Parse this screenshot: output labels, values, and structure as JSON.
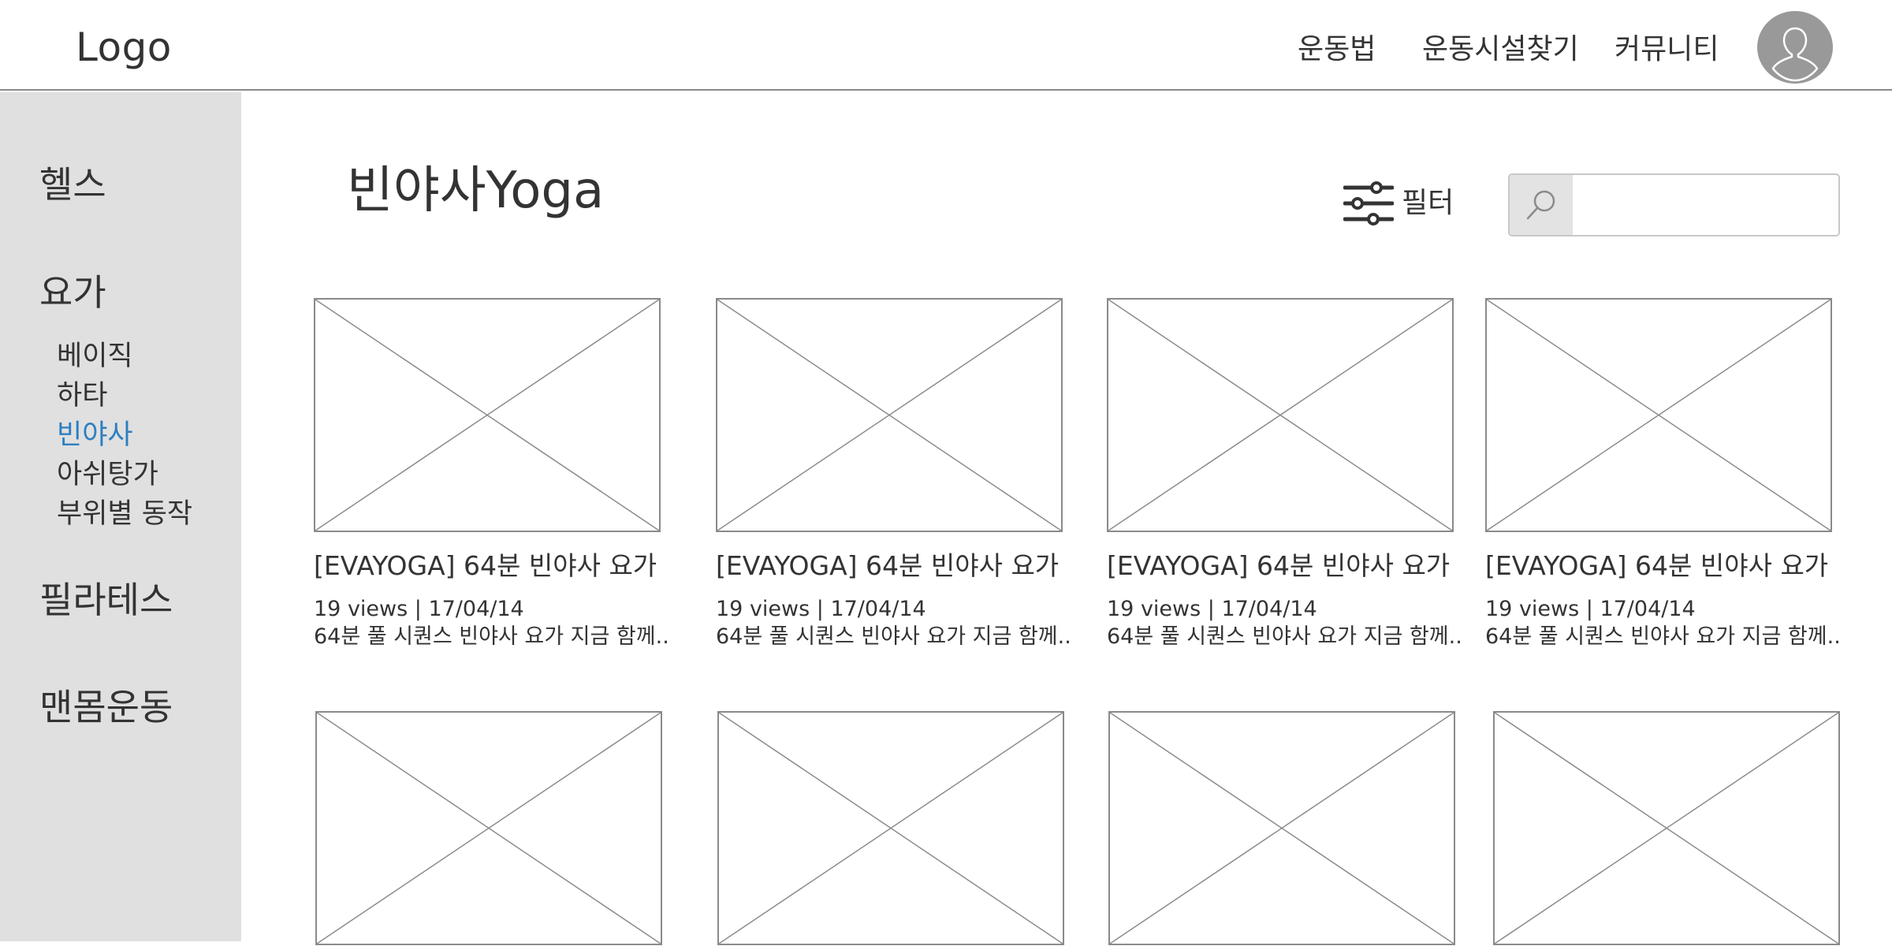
{
  "header": {
    "logo": "Logo",
    "nav": [
      "운동법",
      "운동시설찾기",
      "커뮤니티"
    ]
  },
  "sidebar": {
    "categories": [
      "헬스",
      "요가",
      "필라테스",
      "맨몸운동"
    ],
    "yoga_items": [
      "베이직",
      "하타",
      "빈야사",
      "아쉬탕가",
      "부위별 동작"
    ],
    "active_item": "빈야사"
  },
  "main": {
    "title": "빈야사Yoga",
    "filter_label": "필터",
    "search": {
      "value": "",
      "placeholder": ""
    }
  },
  "cards": [
    {
      "title": "[EVAYOGA] 64분 빈야사 요가",
      "meta": "19 views | 17/04/14",
      "desc": "64분 풀 시퀀스 빈야사 요가 지금 함께.."
    },
    {
      "title": "[EVAYOGA] 64분 빈야사 요가",
      "meta": "19 views | 17/04/14",
      "desc": "64분 풀 시퀀스 빈야사 요가 지금 함께.."
    },
    {
      "title": "[EVAYOGA] 64분 빈야사 요가",
      "meta": "19 views | 17/04/14",
      "desc": "64분 풀 시퀀스 빈야사 요가 지금 함께.."
    },
    {
      "title": "[EVAYOGA] 64분 빈야사 요가",
      "meta": "19 views | 17/04/14",
      "desc": "64분 풀 시퀀스 빈야사 요가 지금 함께.."
    }
  ],
  "colors": {
    "sidebar_bg": "#e0e0e0",
    "active_link": "#2d7fc1",
    "placeholder_stroke": "#8a8a8a",
    "avatar_bg": "#999999"
  },
  "icons": {
    "avatar": "user-silhouette-icon",
    "filter": "sliders-icon",
    "search": "magnifier-icon",
    "thumbnail": "image-placeholder-icon"
  }
}
